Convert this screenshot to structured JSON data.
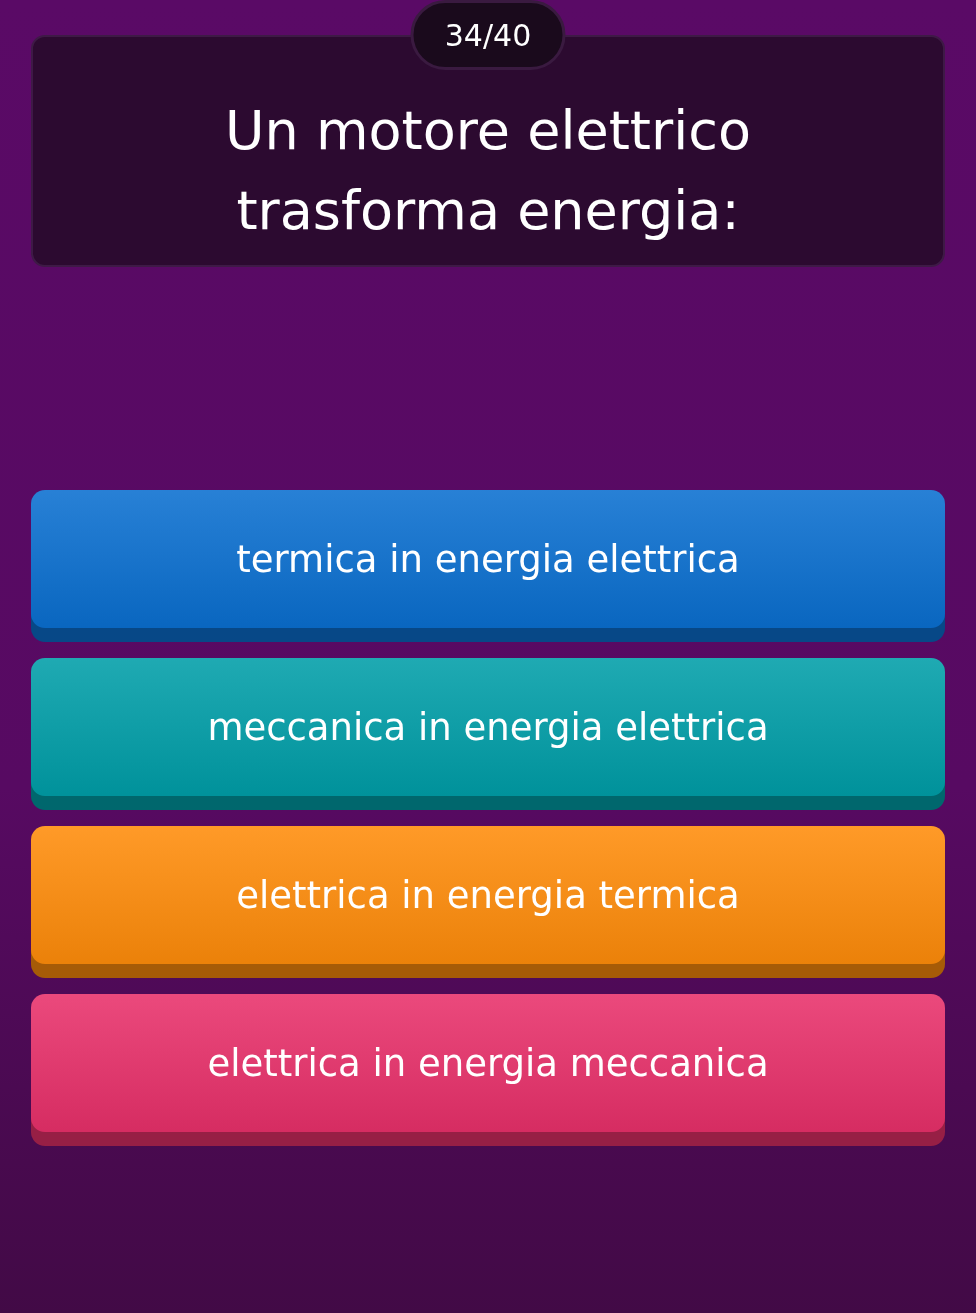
{
  "counter": "34/40",
  "question": "Un motore elettrico trasforma energia:",
  "answers": [
    {
      "label": "termica in energia elettrica",
      "color": "#0a6fd0"
    },
    {
      "label": "meccanica in energia elettrica",
      "color": "#009ea8"
    },
    {
      "label": "elettrica in energia termica",
      "color": "#ff8c0a"
    },
    {
      "label": "elettrica in energia meccanica",
      "color": "#e8306a"
    }
  ]
}
